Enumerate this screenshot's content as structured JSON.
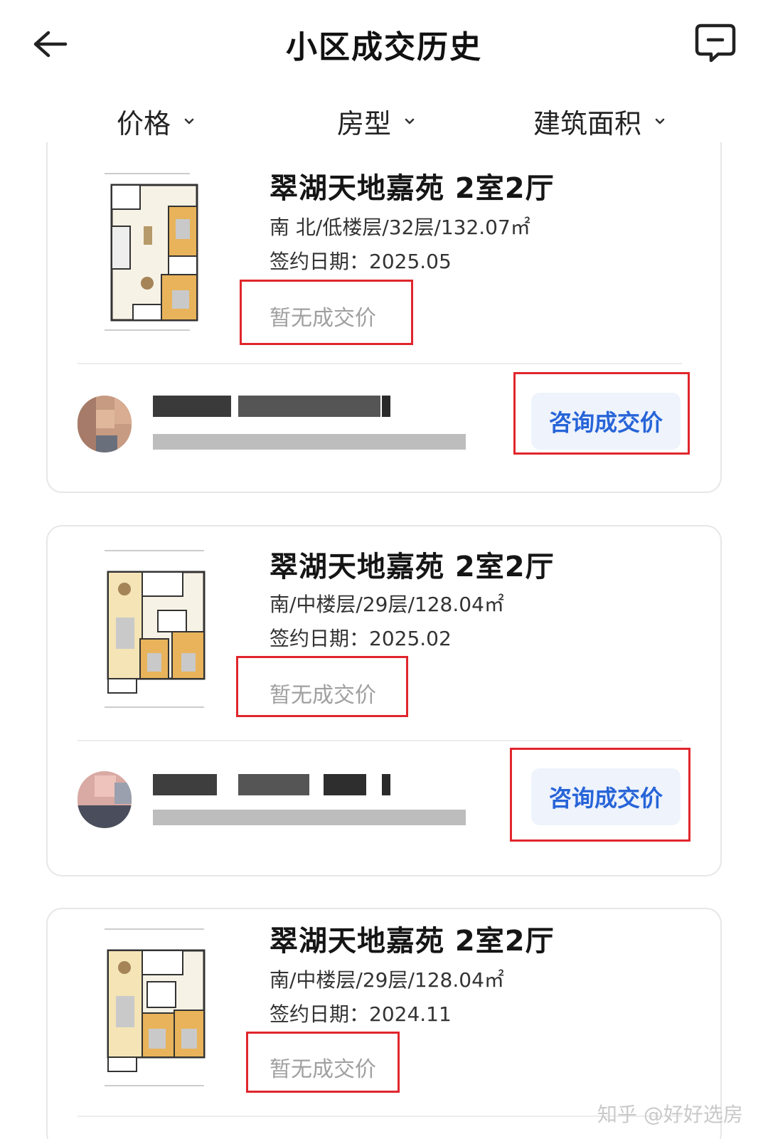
{
  "header": {
    "title": "小区成交历史"
  },
  "filters": [
    {
      "label": "价格"
    },
    {
      "label": "房型"
    },
    {
      "label": "建筑面积"
    }
  ],
  "listings": [
    {
      "title": "翠湖天地嘉苑 2室2厅",
      "meta": "南 北/低楼层/32层/132.07㎡",
      "date": "签约日期：2025.05",
      "price_status": "暂无成交价",
      "consult_label": "咨询成交价"
    },
    {
      "title": "翠湖天地嘉苑 2室2厅",
      "meta": "南/中楼层/29层/128.04㎡",
      "date": "签约日期：2025.02",
      "price_status": "暂无成交价",
      "consult_label": "咨询成交价"
    },
    {
      "title": "翠湖天地嘉苑 2室2厅",
      "meta": "南/中楼层/29层/128.04㎡",
      "date": "签约日期：2024.11",
      "price_status": "暂无成交价"
    }
  ],
  "watermark": "知乎 @好好选房",
  "colors": {
    "accent_blue": "#2764d8",
    "button_bg": "#eef3fc",
    "annotation_red": "#e0262c",
    "muted_text": "#a0a0a0"
  }
}
